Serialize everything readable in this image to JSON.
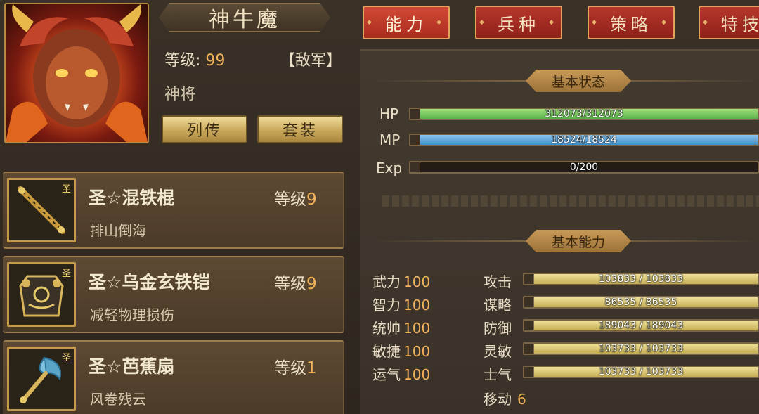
{
  "hero": {
    "name": "神牛魔",
    "level_label": "等级:",
    "level_value": "99",
    "faction": "【敌军】",
    "rank": "神将",
    "buttons": {
      "biography": "列传",
      "set": "套装"
    }
  },
  "equipment": [
    {
      "name": "圣☆混铁棍",
      "level_label": "等级",
      "level": "9",
      "skill": "排山倒海",
      "icon": "iron-staff-icon",
      "badge": "圣"
    },
    {
      "name": "圣☆乌金玄铁铠",
      "level_label": "等级",
      "level": "9",
      "skill": "减轻物理损伤",
      "icon": "armor-icon",
      "badge": "圣"
    },
    {
      "name": "圣☆芭蕉扇",
      "level_label": "等级",
      "level": "1",
      "skill": "风卷残云",
      "icon": "palm-fan-icon",
      "badge": "圣"
    }
  ],
  "tabs": [
    {
      "label": "能力",
      "active": true
    },
    {
      "label": "兵种",
      "active": false
    },
    {
      "label": "策略",
      "active": false
    },
    {
      "label": "特技",
      "active": false
    }
  ],
  "status": {
    "title": "基本状态",
    "hp": {
      "label": "HP",
      "text": "312073/312073",
      "fraction": 1.0,
      "color": "#5bb24a"
    },
    "mp": {
      "label": "MP",
      "text": "18524/18524",
      "fraction": 1.0,
      "color": "#3f8fc8"
    },
    "exp": {
      "label": "Exp",
      "text": "0/200",
      "fraction": 0.0
    }
  },
  "abilities": {
    "title": "基本能力",
    "attributes": [
      {
        "label": "武力",
        "value": "100"
      },
      {
        "label": "智力",
        "value": "100"
      },
      {
        "label": "统帅",
        "value": "100"
      },
      {
        "label": "敏捷",
        "value": "100"
      },
      {
        "label": "运气",
        "value": "100"
      }
    ],
    "stats": [
      {
        "label": "攻击",
        "text": "103833 / 103833",
        "fraction": 1.0
      },
      {
        "label": "谋略",
        "text": "86535 / 86535",
        "fraction": 1.0
      },
      {
        "label": "防御",
        "text": "189043 / 189043",
        "fraction": 1.0
      },
      {
        "label": "灵敏",
        "text": "103733 / 103733",
        "fraction": 1.0
      },
      {
        "label": "士气",
        "text": "103733 / 103733",
        "fraction": 1.0
      }
    ],
    "move": {
      "label": "移动",
      "value": "6"
    }
  }
}
